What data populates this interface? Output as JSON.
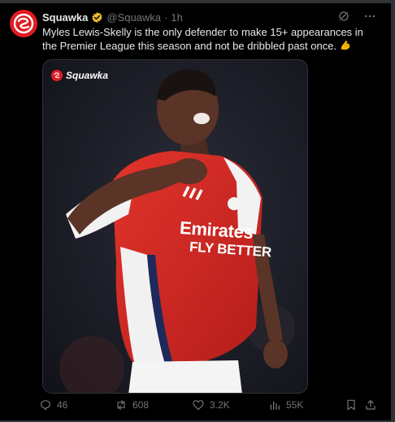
{
  "tweet": {
    "display_name": "Squawka",
    "handle": "@Squawka",
    "separator": "·",
    "time": "1h",
    "text": "Myles Lewis-Skelly is the only defender to make 15+ appearances in the Premier League this season and not be dribbled past once.",
    "emoji": "flexed-biceps"
  },
  "media": {
    "watermark": "Squawka",
    "shirt_sponsor_line1": "Emirates",
    "shirt_sponsor_line2": "FLY BETTER"
  },
  "actions": {
    "replies": "46",
    "reposts": "608",
    "likes": "3.2K",
    "views": "55K"
  },
  "colors": {
    "brand_red": "#e11b22",
    "verified_gold": "#e8b829",
    "muted": "#71767b",
    "text": "#e7e9ea"
  }
}
